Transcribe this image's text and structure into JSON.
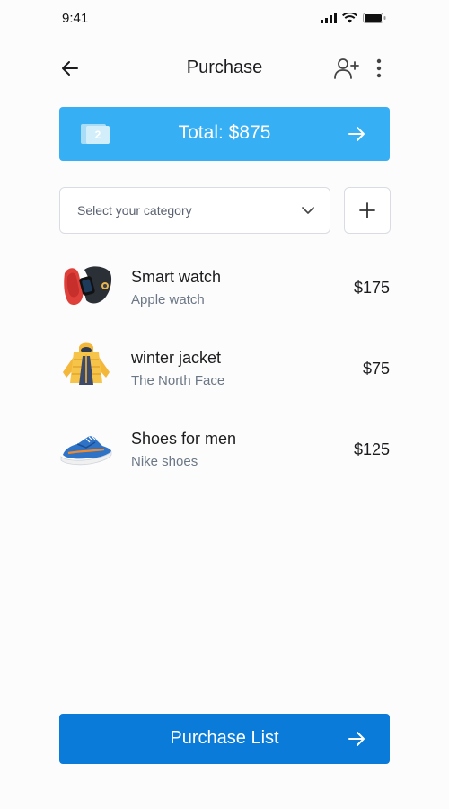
{
  "status_bar": {
    "time": "9:41",
    "icons": [
      "signal-icon",
      "wifi-icon",
      "battery-icon"
    ]
  },
  "header": {
    "title": "Purchase",
    "back_icon": "arrow-left-icon",
    "add_user_icon": "add-user-icon",
    "more_icon": "more-vertical-icon"
  },
  "total_banner": {
    "label": "Total: $875",
    "card_count": "2",
    "background": "#36aff5",
    "arrow_icon": "arrow-right-icon"
  },
  "category": {
    "placeholder": "Select your category",
    "chevron_icon": "chevron-down-icon",
    "add_icon": "plus-icon"
  },
  "products": [
    {
      "name": "Smart watch",
      "brand": "Apple watch",
      "price": "$175",
      "image": "smart-watch-image"
    },
    {
      "name": "winter jacket",
      "brand": "The North Face",
      "price": "$75",
      "image": "winter-jacket-image"
    },
    {
      "name": "Shoes for men",
      "brand": "Nike shoes",
      "price": "$125",
      "image": "shoes-image"
    }
  ],
  "purchase_list_button": {
    "label": "Purchase List",
    "background": "#0a7bd8",
    "arrow_icon": "arrow-right-icon"
  }
}
